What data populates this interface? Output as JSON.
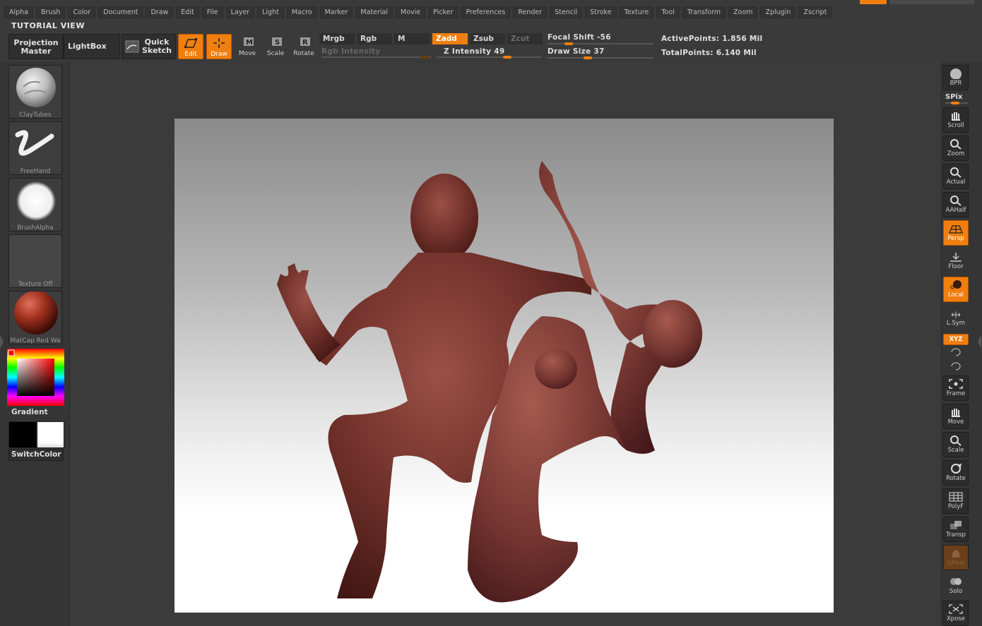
{
  "menu": [
    "Alpha",
    "Brush",
    "Color",
    "Document",
    "Draw",
    "Edit",
    "File",
    "Layer",
    "Light",
    "Macro",
    "Marker",
    "Material",
    "Movie",
    "Picker",
    "Preferences",
    "Render",
    "Stencil",
    "Stroke",
    "Texture",
    "Tool",
    "Transform",
    "Zoom",
    "Zplugin",
    "Zscript"
  ],
  "tutorial_view": "TUTORIAL VIEW",
  "toolbar": {
    "projection_master": [
      "Projection",
      "Master"
    ],
    "lightbox": "LightBox",
    "quick_sketch": [
      "Quick",
      "Sketch"
    ],
    "edit": "Edit",
    "draw": "Draw",
    "move": "Move",
    "scale": "Scale",
    "rotate": "Rotate",
    "mrgb": "Mrgb",
    "rgb": "Rgb",
    "m": "M",
    "zadd": "Zadd",
    "zsub": "Zsub",
    "zcut": "Zcut",
    "rgb_intensity": "Rgb Intensity",
    "z_intensity": "Z Intensity 49",
    "z_intensity_value": 49,
    "focal_shift": "Focal Shift -56",
    "focal_shift_value": -56,
    "draw_size": "Draw Size 37",
    "draw_size_value": 37,
    "active_points": "ActivePoints: 1.856 Mil",
    "total_points": "TotalPoints: 6.140 Mil"
  },
  "left_tray": {
    "brush": "ClayTubes",
    "stroke": "FreeHand",
    "alpha": "BrushAlpha",
    "texture": "Texture Off",
    "material": "MatCap Red Wa",
    "gradient": "Gradient",
    "switch_color": "SwitchColor"
  },
  "right_tray": {
    "bpr": "BPR",
    "spix": "SPix",
    "scroll": "Scroll",
    "zoom": "Zoom",
    "actual": "Actual",
    "aahalf": "AAHalf",
    "persp": "Persp",
    "floor": "Floor",
    "local": "Local",
    "lsym": "L.Sym",
    "xyz": "XYZ",
    "frame": "Frame",
    "move": "Move",
    "scale": "Scale",
    "rotate": "Rotate",
    "polyf": "PolyF",
    "transp": "Transp",
    "ghost": "Ghost",
    "solo": "Solo",
    "xpose": "Xpose"
  },
  "colors": {
    "accent": "#f07f10",
    "sculpt": "#7a3a32"
  }
}
